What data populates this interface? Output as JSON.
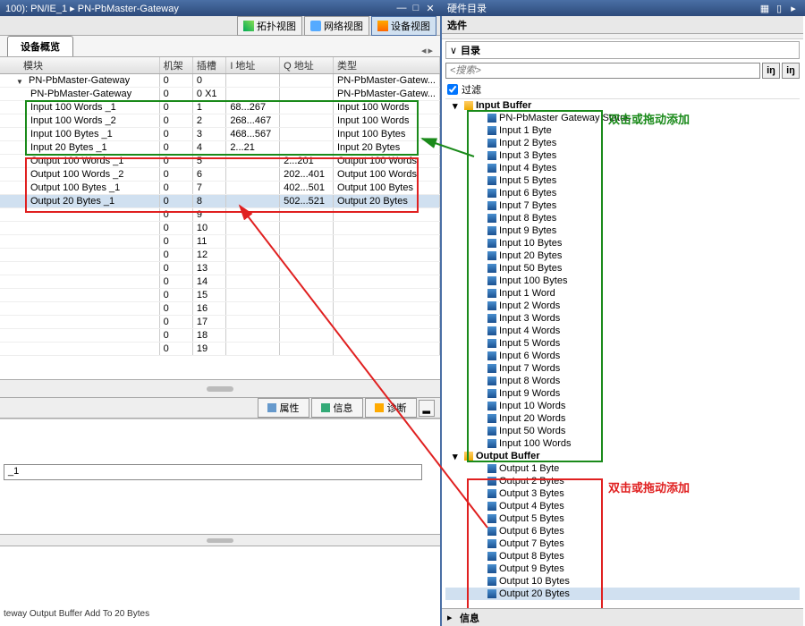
{
  "left_title": "100): PN/IE_1 ▸ PN-PbMaster-Gateway",
  "right_title": "硬件目录",
  "viewbuttons": {
    "topo": "拓扑视图",
    "net": "网络视图",
    "dev": "设备视图"
  },
  "overview_tab": "设备概览",
  "grid_headers": {
    "module": "模块",
    "rack": "机架",
    "slot": "插槽",
    "iaddr": "I 地址",
    "qaddr": "Q 地址",
    "type": "类型"
  },
  "rows": [
    {
      "pad": 1,
      "module": "PN-PbMaster-Gateway",
      "rack": "0",
      "slot": "0",
      "i": "",
      "q": "",
      "type": "PN-PbMaster-Gatew...",
      "root": true
    },
    {
      "pad": 2,
      "module": "PN-PbMaster-Gateway",
      "rack": "0",
      "slot": "0 X1",
      "i": "",
      "q": "",
      "type": "PN-PbMaster-Gatew..."
    },
    {
      "pad": 2,
      "module": "Input 100 Words _1",
      "rack": "0",
      "slot": "1",
      "i": "68...267",
      "q": "",
      "type": "Input 100 Words"
    },
    {
      "pad": 2,
      "module": "Input 100 Words _2",
      "rack": "0",
      "slot": "2",
      "i": "268...467",
      "q": "",
      "type": "Input 100 Words"
    },
    {
      "pad": 2,
      "module": "Input 100 Bytes _1",
      "rack": "0",
      "slot": "3",
      "i": "468...567",
      "q": "",
      "type": "Input 100 Bytes"
    },
    {
      "pad": 2,
      "module": "Input 20 Bytes _1",
      "rack": "0",
      "slot": "4",
      "i": "2...21",
      "q": "",
      "type": "Input 20 Bytes"
    },
    {
      "pad": 2,
      "module": "Output 100 Words _1",
      "rack": "0",
      "slot": "5",
      "i": "",
      "q": "2...201",
      "type": "Output 100 Words"
    },
    {
      "pad": 2,
      "module": "Output 100 Words _2",
      "rack": "0",
      "slot": "6",
      "i": "",
      "q": "202...401",
      "type": "Output 100 Words"
    },
    {
      "pad": 2,
      "module": "Output 100 Bytes _1",
      "rack": "0",
      "slot": "7",
      "i": "",
      "q": "402...501",
      "type": "Output 100 Bytes"
    },
    {
      "pad": 2,
      "module": "Output 20 Bytes _1",
      "rack": "0",
      "slot": "8",
      "i": "",
      "q": "502...521",
      "type": "Output 20 Bytes",
      "sel": true
    },
    {
      "pad": 2,
      "module": "",
      "rack": "0",
      "slot": "9",
      "i": "",
      "q": "",
      "type": ""
    },
    {
      "pad": 2,
      "module": "",
      "rack": "0",
      "slot": "10",
      "i": "",
      "q": "",
      "type": ""
    },
    {
      "pad": 2,
      "module": "",
      "rack": "0",
      "slot": "11",
      "i": "",
      "q": "",
      "type": ""
    },
    {
      "pad": 2,
      "module": "",
      "rack": "0",
      "slot": "12",
      "i": "",
      "q": "",
      "type": ""
    },
    {
      "pad": 2,
      "module": "",
      "rack": "0",
      "slot": "13",
      "i": "",
      "q": "",
      "type": ""
    },
    {
      "pad": 2,
      "module": "",
      "rack": "0",
      "slot": "14",
      "i": "",
      "q": "",
      "type": ""
    },
    {
      "pad": 2,
      "module": "",
      "rack": "0",
      "slot": "15",
      "i": "",
      "q": "",
      "type": ""
    },
    {
      "pad": 2,
      "module": "",
      "rack": "0",
      "slot": "16",
      "i": "",
      "q": "",
      "type": ""
    },
    {
      "pad": 2,
      "module": "",
      "rack": "0",
      "slot": "17",
      "i": "",
      "q": "",
      "type": ""
    },
    {
      "pad": 2,
      "module": "",
      "rack": "0",
      "slot": "18",
      "i": "",
      "q": "",
      "type": ""
    },
    {
      "pad": 2,
      "module": "",
      "rack": "0",
      "slot": "19",
      "i": "",
      "q": "",
      "type": ""
    }
  ],
  "proptabs": {
    "prop": "属性",
    "info": "信息",
    "diag": "诊断"
  },
  "prop_field": "_1",
  "prop_line3": "teway Output Buffer Add To 20 Bytes",
  "right": {
    "options": "选件",
    "catalog": "目录",
    "search_placeholder": "<搜索>",
    "filter": "过滤",
    "input_buffer": "Input Buffer",
    "output_buffer": "Output Buffer",
    "input_items": [
      "PN-PbMaster Gateway Status",
      "Input 1 Byte",
      "Input 2 Bytes",
      "Input 3 Bytes",
      "Input 4 Bytes",
      "Input 5 Bytes",
      "Input 6 Bytes",
      "Input 7 Bytes",
      "Input 8 Bytes",
      "Input 9 Bytes",
      "Input 10 Bytes",
      "Input 20 Bytes",
      "Input 50 Bytes",
      "Input 100 Bytes",
      "Input 1 Word",
      "Input 2 Words",
      "Input 3 Words",
      "Input 4 Words",
      "Input 5 Words",
      "Input 6 Words",
      "Input 7 Words",
      "Input 8 Words",
      "Input 9 Words",
      "Input 10 Words",
      "Input 20 Words",
      "Input 50 Words",
      "Input 100 Words"
    ],
    "output_items": [
      "Output 1 Byte",
      "Output 2 Bytes",
      "Output 3 Bytes",
      "Output 4 Bytes",
      "Output 5 Bytes",
      "Output 6 Bytes",
      "Output 7 Bytes",
      "Output 8 Bytes",
      "Output 9 Bytes",
      "Output 10 Bytes",
      "Output 20 Bytes"
    ],
    "info": "信息"
  },
  "annotations": {
    "green": "双击或拖动添加",
    "red": "双击或拖动添加"
  }
}
